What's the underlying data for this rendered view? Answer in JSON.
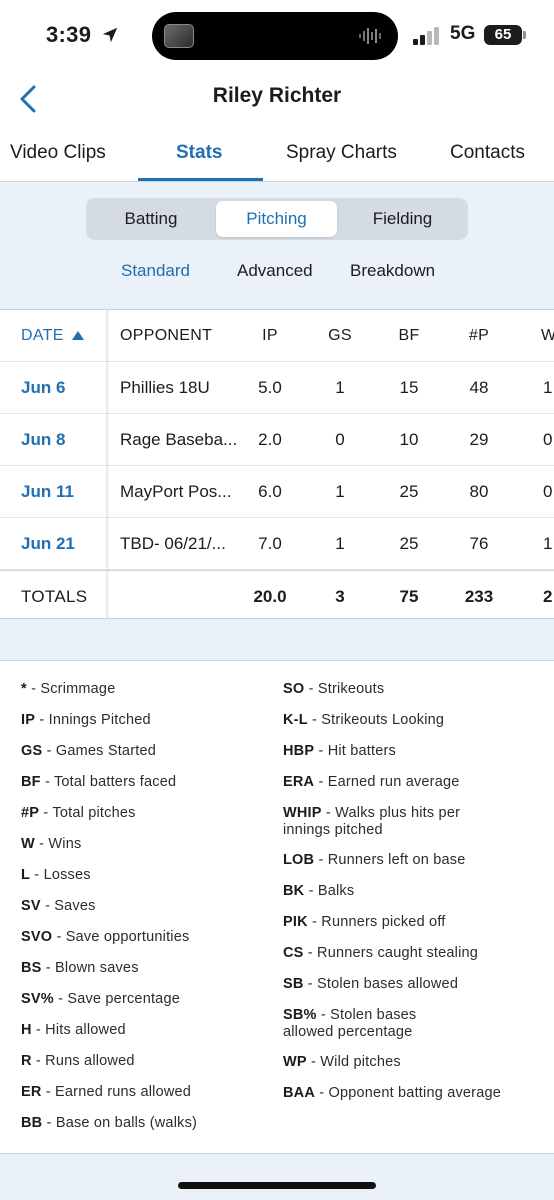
{
  "status": {
    "time": "3:39",
    "network": "5G",
    "battery": "65"
  },
  "nav": {
    "title": "Riley Richter"
  },
  "tabs": [
    {
      "label": "Video Clips",
      "active": false
    },
    {
      "label": "Stats",
      "active": true
    },
    {
      "label": "Spray Charts",
      "active": false
    },
    {
      "label": "Contacts",
      "active": false
    }
  ],
  "segments": [
    {
      "label": "Batting",
      "active": false
    },
    {
      "label": "Pitching",
      "active": true
    },
    {
      "label": "Fielding",
      "active": false
    }
  ],
  "subtabs": [
    {
      "label": "Standard",
      "active": true
    },
    {
      "label": "Advanced",
      "active": false
    },
    {
      "label": "Breakdown",
      "active": false
    }
  ],
  "table": {
    "headers": [
      "DATE",
      "OPPONENT",
      "IP",
      "GS",
      "BF",
      "#P",
      "W"
    ],
    "rows": [
      {
        "date": "Jun 6",
        "opponent": "Phillies 18U",
        "ip": "5.0",
        "gs": "1",
        "bf": "15",
        "p": "48",
        "w": "1"
      },
      {
        "date": "Jun 8",
        "opponent": "Rage Baseba...",
        "ip": "2.0",
        "gs": "0",
        "bf": "10",
        "p": "29",
        "w": "0"
      },
      {
        "date": "Jun 11",
        "opponent": "MayPort Pos...",
        "ip": "6.0",
        "gs": "1",
        "bf": "25",
        "p": "80",
        "w": "0"
      },
      {
        "date": "Jun 21",
        "opponent": "TBD- 06/21/...",
        "ip": "7.0",
        "gs": "1",
        "bf": "25",
        "p": "76",
        "w": "1"
      }
    ],
    "totals": {
      "label": "TOTALS",
      "ip": "20.0",
      "gs": "3",
      "bf": "75",
      "p": "233",
      "w": "2"
    }
  },
  "legend": {
    "left": [
      {
        "abbr": "*",
        "desc": "Scrimmage"
      },
      {
        "abbr": "IP",
        "desc": "Innings Pitched"
      },
      {
        "abbr": "GS",
        "desc": "Games Started"
      },
      {
        "abbr": "BF",
        "desc": "Total batters faced"
      },
      {
        "abbr": "#P",
        "desc": "Total pitches"
      },
      {
        "abbr": "W",
        "desc": "Wins"
      },
      {
        "abbr": "L",
        "desc": "Losses"
      },
      {
        "abbr": "SV",
        "desc": "Saves"
      },
      {
        "abbr": "SVO",
        "desc": "Save opportunities"
      },
      {
        "abbr": "BS",
        "desc": "Blown saves"
      },
      {
        "abbr": "SV%",
        "desc": "Save percentage"
      },
      {
        "abbr": "H",
        "desc": "Hits allowed"
      },
      {
        "abbr": "R",
        "desc": "Runs allowed"
      },
      {
        "abbr": "ER",
        "desc": "Earned runs allowed"
      },
      {
        "abbr": "BB",
        "desc": "Base on balls (walks)"
      }
    ],
    "right": [
      {
        "abbr": "SO",
        "desc": "Strikeouts"
      },
      {
        "abbr": "K-L",
        "desc": "Strikeouts Looking"
      },
      {
        "abbr": "HBP",
        "desc": "Hit batters"
      },
      {
        "abbr": "ERA",
        "desc": "Earned run average"
      },
      {
        "abbr": "WHIP",
        "desc": "Walks plus hits per innings pitched"
      },
      {
        "abbr": "LOB",
        "desc": "Runners left on base"
      },
      {
        "abbr": "BK",
        "desc": "Balks"
      },
      {
        "abbr": "PIK",
        "desc": "Runners picked off"
      },
      {
        "abbr": "CS",
        "desc": "Runners caught stealing"
      },
      {
        "abbr": "SB",
        "desc": "Stolen bases allowed"
      },
      {
        "abbr": "SB%",
        "desc": "Stolen bases allowed percentage"
      },
      {
        "abbr": "WP",
        "desc": "Wild pitches"
      },
      {
        "abbr": "BAA",
        "desc": "Opponent batting average"
      }
    ]
  },
  "colors": {
    "accent": "#1f6fb2",
    "background": "#eaf1f8"
  },
  "icons": {
    "location": "location-arrow-icon",
    "back": "chevron-left-icon",
    "sort": "sort-ascending-icon",
    "signal": "cellular-signal-icon",
    "battery": "battery-icon"
  }
}
